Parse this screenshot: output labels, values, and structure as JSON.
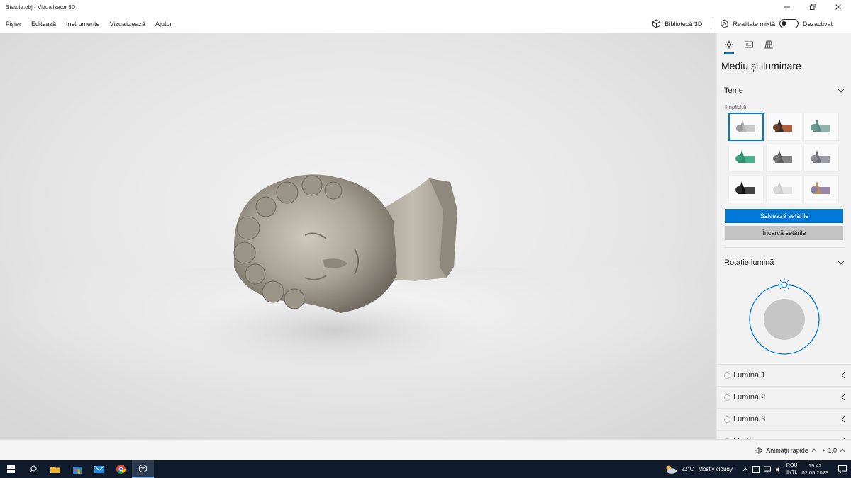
{
  "window": {
    "title": "Statuie.obj - Vizualizator 3D",
    "controls": [
      "minimize",
      "restore",
      "close"
    ]
  },
  "menu": {
    "items": [
      "Fișier",
      "Editează",
      "Instrumente",
      "Vizualizează",
      "Ajutor"
    ],
    "library_label": "Bibliotecă 3D",
    "mixed_reality_label": "Realitate mixtă",
    "toggle_state": "Dezactivat"
  },
  "panel": {
    "tabs": [
      "environment-lighting",
      "stats",
      "grid"
    ],
    "title": "Mediu și iluminare",
    "themes_section": "Teme",
    "themes_sub": "Implicită",
    "themes": [
      {
        "name": "default",
        "colors": [
          "#9a9a9a",
          "#b5b5b5",
          "#c8c8c8"
        ]
      },
      {
        "name": "brown",
        "colors": [
          "#6b3b2a",
          "#3b2c2a",
          "#b0603e"
        ]
      },
      {
        "name": "teal",
        "colors": [
          "#6f9b97",
          "#5a8a86",
          "#8db3ad"
        ]
      },
      {
        "name": "green",
        "colors": [
          "#3a9e7d",
          "#2f8c6d",
          "#47b38d"
        ]
      },
      {
        "name": "gray",
        "colors": [
          "#6f6f6f",
          "#5d5d5d",
          "#858585"
        ]
      },
      {
        "name": "slate",
        "colors": [
          "#888893",
          "#6c6c78",
          "#9c9ca8"
        ]
      },
      {
        "name": "black",
        "colors": [
          "#2a2a2a",
          "#111111",
          "#444444"
        ]
      },
      {
        "name": "white",
        "colors": [
          "#d9d9d9",
          "#cfcfcf",
          "#e5e5e5"
        ]
      },
      {
        "name": "copper",
        "colors": [
          "#8a7fa0",
          "#c18a54",
          "#9a86a8"
        ]
      }
    ],
    "save_label": "Salvează setările",
    "load_label": "Încarcă setările",
    "rotation_section": "Rotație lumină",
    "lights": [
      "Lumină 1",
      "Lumină 2",
      "Lumină 3",
      "Mediu"
    ]
  },
  "statusbar": {
    "animations_label": "Animații rapide",
    "speed_label": "× 1,0"
  },
  "taskbar": {
    "weather_temp": "22°C",
    "weather_text": "Mostly cloudy",
    "lang_top": "ROU",
    "lang_bottom": "INTL",
    "time": "19:42",
    "date": "02.05.2023"
  },
  "colors": {
    "accent": "#0078d7",
    "taskbar": "#0f1a2a",
    "panel_bg": "#f2f2f2"
  }
}
